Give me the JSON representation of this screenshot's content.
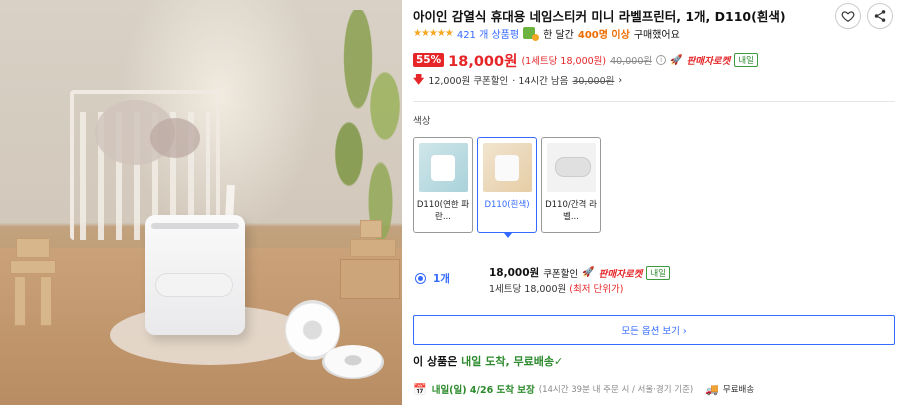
{
  "product": {
    "title": "아이인 감열식 휴대용 네임스티커 미니 라벨프린터, 1개, D110(흰색)"
  },
  "rating": {
    "stars": "★★★★★",
    "review_count": "421 개 상품평",
    "purchase_prefix": "한 달간",
    "purchase_count": "400명 이상",
    "purchase_suffix": "구매했어요"
  },
  "price": {
    "discount_pct": "55%",
    "sale_price": "18,000원",
    "unit_price": "(1세트당 18,000원)",
    "original_price": "40,000원",
    "rocket_label": "판매자로켓",
    "tomorrow_badge": "내일"
  },
  "coupon": {
    "discount": "12,000원 쿠폰할인",
    "remaining": "· 14시간 남음",
    "prev_price": "30,000원",
    "chevron": "›"
  },
  "options": {
    "section_label": "색상",
    "items": [
      {
        "label": "D110(연한 파란...",
        "selected": false
      },
      {
        "label": "D110(흰색)",
        "selected": true
      },
      {
        "label": "D110/간격 라벨...",
        "selected": false
      }
    ]
  },
  "quantity": {
    "label": "1개",
    "price": "18,000원",
    "coupon_text": "쿠폰할인",
    "rocket_label": "판매자로켓",
    "tomorrow_badge": "내일",
    "unit_line": "1세트당 18,000원",
    "lowest_note": "(최저 단위가)"
  },
  "all_options_button": "모든 옵션 보기 ›",
  "arrival": {
    "prefix": "이 상품은",
    "highlight": "내일 도착, 무료배송",
    "check": "✓"
  },
  "delivery": {
    "date": "내일(일) 4/26 도착 보장",
    "condition": "(14시간 39분 내 주문 시 / 서울·경기 기준)",
    "free_shipping": "무료배송"
  },
  "colors": {
    "accent_blue": "#346aff",
    "sale_red": "#e52528",
    "green": "#2c8a2c"
  }
}
